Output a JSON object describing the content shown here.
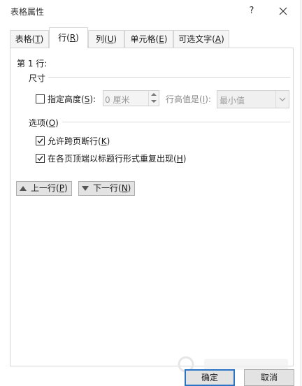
{
  "window": {
    "title": "表格属性",
    "help_glyph": "?"
  },
  "tabs": [
    {
      "label": "表格(",
      "key": "T",
      "suffix": ")"
    },
    {
      "label": "行(",
      "key": "R",
      "suffix": ")"
    },
    {
      "label": "列(",
      "key": "U",
      "suffix": ")"
    },
    {
      "label": "单元格(",
      "key": "E",
      "suffix": ")"
    },
    {
      "label": "可选文字(",
      "key": "A",
      "suffix": ")"
    }
  ],
  "row_panel": {
    "row_label": "第 1 行:",
    "size_group": {
      "title": "尺寸",
      "height_checkbox": {
        "label": "指定高度(",
        "key": "S",
        "suffix": "):",
        "checked": false
      },
      "height_value": "0 厘米",
      "row_height_is": {
        "label": "行高值是(",
        "key": "I",
        "suffix": "):"
      },
      "row_height_mode": "最小值"
    },
    "options_group": {
      "title": "选项(",
      "key": "O",
      "suffix": ")",
      "allow_break": {
        "label": "允许跨页断行(",
        "key": "K",
        "suffix": ")",
        "checked": true
      },
      "repeat_header": {
        "label": "在各页顶端以标题行形式重复出现(",
        "key": "H",
        "suffix": ")",
        "checked": true
      }
    },
    "prev_row_button": {
      "label": "上一行(",
      "key": "P",
      "suffix": ")"
    },
    "next_row_button": {
      "label": "下一行(",
      "key": "N",
      "suffix": ")"
    }
  },
  "footer": {
    "ok_label": "确定",
    "cancel_label": "取消"
  },
  "colors": {
    "accent": "#2b73c4",
    "border": "#d6d6d6",
    "button_face": "#e3e3e3",
    "disabled_text": "#9a9a9a"
  }
}
